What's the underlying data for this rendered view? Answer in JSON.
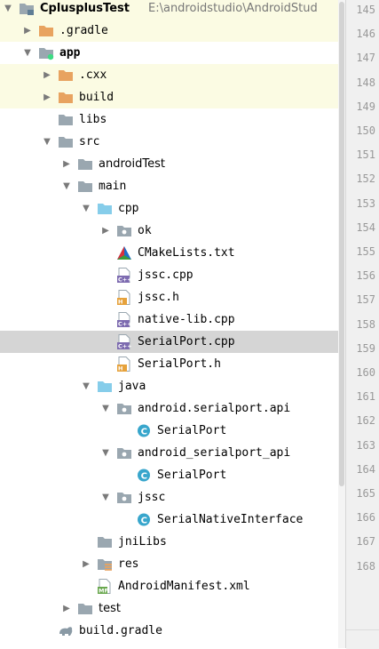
{
  "tree": [
    {
      "label": "CplusplusTest",
      "suffix": "E:\\androidstudio\\AndroidStud",
      "depth": 0,
      "arrow": "open",
      "icon": "module-folder-icon",
      "bold": true,
      "mono": false,
      "hl": "yellow"
    },
    {
      "label": ".gradle",
      "depth": 1,
      "arrow": "closed",
      "icon": "orange-folder-icon",
      "mono": true,
      "hl": "yellow"
    },
    {
      "label": "app",
      "depth": 1,
      "arrow": "open",
      "icon": "android-module-folder-icon",
      "bold": true,
      "mono": true
    },
    {
      "label": ".cxx",
      "depth": 2,
      "arrow": "closed",
      "icon": "orange-folder-icon",
      "mono": true,
      "hl": "yellow"
    },
    {
      "label": "build",
      "depth": 2,
      "arrow": "closed",
      "icon": "orange-folder-icon",
      "mono": true,
      "hl": "yellow"
    },
    {
      "label": "libs",
      "depth": 2,
      "arrow": "none",
      "icon": "folder-icon",
      "mono": true
    },
    {
      "label": "src",
      "depth": 2,
      "arrow": "open",
      "icon": "folder-icon",
      "mono": true
    },
    {
      "label": "androidTest",
      "depth": 3,
      "arrow": "closed",
      "icon": "folder-icon",
      "mono": false
    },
    {
      "label": "main",
      "depth": 3,
      "arrow": "open",
      "icon": "folder-icon",
      "mono": true
    },
    {
      "label": "cpp",
      "depth": 4,
      "arrow": "open",
      "icon": "blue-folder-icon",
      "mono": true
    },
    {
      "label": "ok",
      "depth": 5,
      "arrow": "closed",
      "icon": "package-folder-icon",
      "mono": true
    },
    {
      "label": "CMakeLists.txt",
      "depth": 5,
      "arrow": "none",
      "icon": "cmake-icon",
      "mono": true
    },
    {
      "label": "jssc.cpp",
      "depth": 5,
      "arrow": "none",
      "icon": "cpp-file-icon",
      "mono": true
    },
    {
      "label": "jssc.h",
      "depth": 5,
      "arrow": "none",
      "icon": "header-file-icon",
      "mono": true
    },
    {
      "label": "native-lib.cpp",
      "depth": 5,
      "arrow": "none",
      "icon": "cpp-file-icon",
      "mono": true
    },
    {
      "label": "SerialPort.cpp",
      "depth": 5,
      "arrow": "none",
      "icon": "cpp-file-icon",
      "mono": true,
      "hl": "sel"
    },
    {
      "label": "SerialPort.h",
      "depth": 5,
      "arrow": "none",
      "icon": "header-file-icon",
      "mono": true
    },
    {
      "label": "java",
      "depth": 4,
      "arrow": "open",
      "icon": "blue-folder-icon",
      "mono": true
    },
    {
      "label": "android.serialport.api",
      "depth": 5,
      "arrow": "open",
      "icon": "package-folder-icon",
      "mono": true
    },
    {
      "label": "SerialPort",
      "depth": 6,
      "arrow": "none",
      "icon": "class-icon",
      "mono": true
    },
    {
      "label": "android_serialport_api",
      "depth": 5,
      "arrow": "open",
      "icon": "package-folder-icon",
      "mono": true
    },
    {
      "label": "SerialPort",
      "depth": 6,
      "arrow": "none",
      "icon": "class-icon",
      "mono": true
    },
    {
      "label": "jssc",
      "depth": 5,
      "arrow": "open",
      "icon": "package-folder-icon",
      "mono": true
    },
    {
      "label": "SerialNativeInterface",
      "depth": 6,
      "arrow": "none",
      "icon": "class-icon",
      "mono": true
    },
    {
      "label": "jniLibs",
      "depth": 4,
      "arrow": "none",
      "icon": "folder-icon",
      "mono": true
    },
    {
      "label": "res",
      "depth": 4,
      "arrow": "closed",
      "icon": "resource-folder-icon",
      "mono": true
    },
    {
      "label": "AndroidManifest.xml",
      "depth": 4,
      "arrow": "none",
      "icon": "manifest-file-icon",
      "mono": true
    },
    {
      "label": "test",
      "depth": 3,
      "arrow": "closed",
      "icon": "folder-icon",
      "mono": false
    },
    {
      "label": "build.gradle",
      "depth": 2,
      "arrow": "none",
      "icon": "gradle-icon",
      "mono": true
    }
  ],
  "gutter": {
    "line_numbers": [
      "145",
      "146",
      "147",
      "148",
      "149",
      "150",
      "151",
      "152",
      "153",
      "154",
      "155",
      "156",
      "157",
      "158",
      "159",
      "160",
      "161",
      "162",
      "163",
      "164",
      "165",
      "166",
      "167",
      "168"
    ]
  },
  "colors": {
    "highlight_yellow": "#fbfbe3",
    "selection": "#d5d5d5",
    "folder_gray": "#9aa7b0",
    "folder_orange": "#e8a360",
    "folder_blue": "#86cdea",
    "cpp_purple": "#7d6bb0",
    "header_orange": "#e6a23c",
    "class_teal": "#38a6cc"
  }
}
